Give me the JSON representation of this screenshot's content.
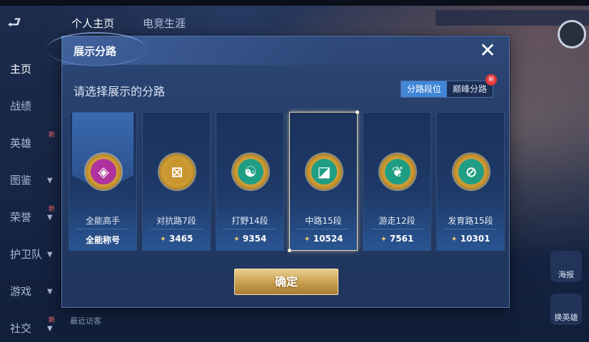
{
  "background": {
    "top_tabs": [
      "个人主页",
      "电竞生涯"
    ],
    "sidebar": [
      {
        "label": "主页",
        "active": true,
        "new": false,
        "chevron": false
      },
      {
        "label": "战绩",
        "active": false,
        "new": false,
        "chevron": false
      },
      {
        "label": "英雄",
        "active": false,
        "new": true,
        "chevron": false
      },
      {
        "label": "图鉴",
        "active": false,
        "new": false,
        "chevron": true
      },
      {
        "label": "荣誉",
        "active": false,
        "new": true,
        "chevron": true
      },
      {
        "label": "护卫队",
        "active": false,
        "new": false,
        "chevron": true
      },
      {
        "label": "游戏",
        "active": false,
        "new": false,
        "chevron": true
      },
      {
        "label": "社交",
        "active": false,
        "new": true,
        "chevron": true
      }
    ],
    "new_badge": "新",
    "recent_visitors": "最近访客",
    "right_buttons": [
      "海报",
      "换英雄"
    ]
  },
  "modal": {
    "title": "展示分路",
    "prompt": "请选择展示的分路",
    "toggle": {
      "options": [
        "分路段位",
        "巅峰分路"
      ],
      "active_index": 0,
      "new_badge": "新"
    },
    "cards": [
      {
        "lane": "全能高手",
        "score": "全能称号",
        "emblem_color": "#b0329e",
        "icon": "all-around-icon",
        "selected": false,
        "first": true,
        "glyph": "◈"
      },
      {
        "lane": "对抗路7段",
        "score": "3465",
        "emblem_color": "#c9962f",
        "icon": "clash-lane-icon",
        "selected": false,
        "first": false,
        "glyph": "⊠"
      },
      {
        "lane": "打野14段",
        "score": "9354",
        "emblem_color": "#1f9e83",
        "icon": "jungle-icon",
        "selected": false,
        "first": false,
        "glyph": "☯"
      },
      {
        "lane": "中路15段",
        "score": "10524",
        "emblem_color": "#1f9e83",
        "icon": "mid-lane-icon",
        "selected": true,
        "first": false,
        "glyph": "◪"
      },
      {
        "lane": "游走12段",
        "score": "7561",
        "emblem_color": "#1f9e83",
        "icon": "roam-icon",
        "selected": false,
        "first": false,
        "glyph": "❦"
      },
      {
        "lane": "发育路15段",
        "score": "10301",
        "emblem_color": "#1f9e83",
        "icon": "farm-lane-icon",
        "selected": false,
        "first": false,
        "glyph": "⊘"
      }
    ],
    "rank_glyph": "✦",
    "confirm_label": "确定"
  }
}
